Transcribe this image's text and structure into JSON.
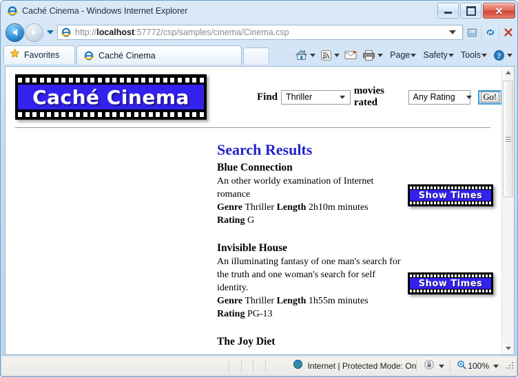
{
  "window": {
    "title": "Caché Cinema - Windows Internet Explorer",
    "icon": "ie-logo-icon",
    "minimize_label": "Minimize",
    "maximize_label": "Maximize",
    "close_label": "Close"
  },
  "browser": {
    "back_label": "Back",
    "forward_label": "Forward",
    "history_dropdown_label": "Recent Pages",
    "url_display_prefix": "http://",
    "url_host": "localhost",
    "url_rest": ":57772/csp/samples/cinema/Cinema.csp",
    "url_full": "http://localhost:57772/csp/samples/cinema/Cinema.csp",
    "url_dropdown_label": "Address dropdown",
    "compat_view_label": "Compatibility View",
    "refresh_label": "Refresh",
    "stop_label": "Stop",
    "favorites_label": "Favorites",
    "tab_label": "Caché Cinema",
    "new_tab_label": "New Tab",
    "commands": [
      {
        "name": "home",
        "label": "Home",
        "icon": "home-icon",
        "has_caret": true
      },
      {
        "name": "feeds",
        "label": "Feeds",
        "icon": "rss-icon",
        "has_caret": true
      },
      {
        "name": "mail",
        "label": "Read Mail",
        "icon": "mail-icon",
        "has_caret": false
      },
      {
        "name": "print",
        "label": "Print",
        "icon": "printer-icon",
        "has_caret": true
      },
      {
        "name": "page",
        "label": "Page",
        "icon": "",
        "has_caret": true
      },
      {
        "name": "safety",
        "label": "Safety",
        "icon": "",
        "has_caret": true
      },
      {
        "name": "tools",
        "label": "Tools",
        "icon": "",
        "has_caret": true
      },
      {
        "name": "help",
        "label": "",
        "icon": "help-icon",
        "has_caret": true
      }
    ]
  },
  "site": {
    "logo_text": "Caché Cinema",
    "find_label": "Find",
    "genre_value": "Thriller",
    "movies_rated_label": "movies rated",
    "rating_value": "Any Rating",
    "go_label": "Go!"
  },
  "results": {
    "heading": "Search Results",
    "genre_label": "Genre",
    "length_label": "Length",
    "rating_label": "Rating",
    "showtimes_label": "Show Times",
    "movies": [
      {
        "title": "Blue Connection",
        "description": "An other worldy examination of Internet romance",
        "genre": "Thriller",
        "length": "2h10m minutes",
        "rating": "G"
      },
      {
        "title": "Invisible House",
        "description": "An illuminating fantasy of one man's search for the truth and one woman's search for self identity.",
        "genre": "Thriller",
        "length": "1h55m minutes",
        "rating": "PG-13"
      },
      {
        "title": "The Joy Diet",
        "description": "",
        "genre": "",
        "length": "",
        "rating": ""
      }
    ]
  },
  "statusbar": {
    "zone_text": "Internet | Protected Mode: On",
    "zone_icon": "globe-icon",
    "privacy_icon": "privacy-lock-icon",
    "zoom_icon": "zoom-magnifier-icon",
    "zoom_level": "100%"
  },
  "colors": {
    "logo_blue": "#3322ee",
    "heading_blue": "#2222cc",
    "close_red": "#cf4433",
    "frame_blue": "#b9d6ef"
  }
}
